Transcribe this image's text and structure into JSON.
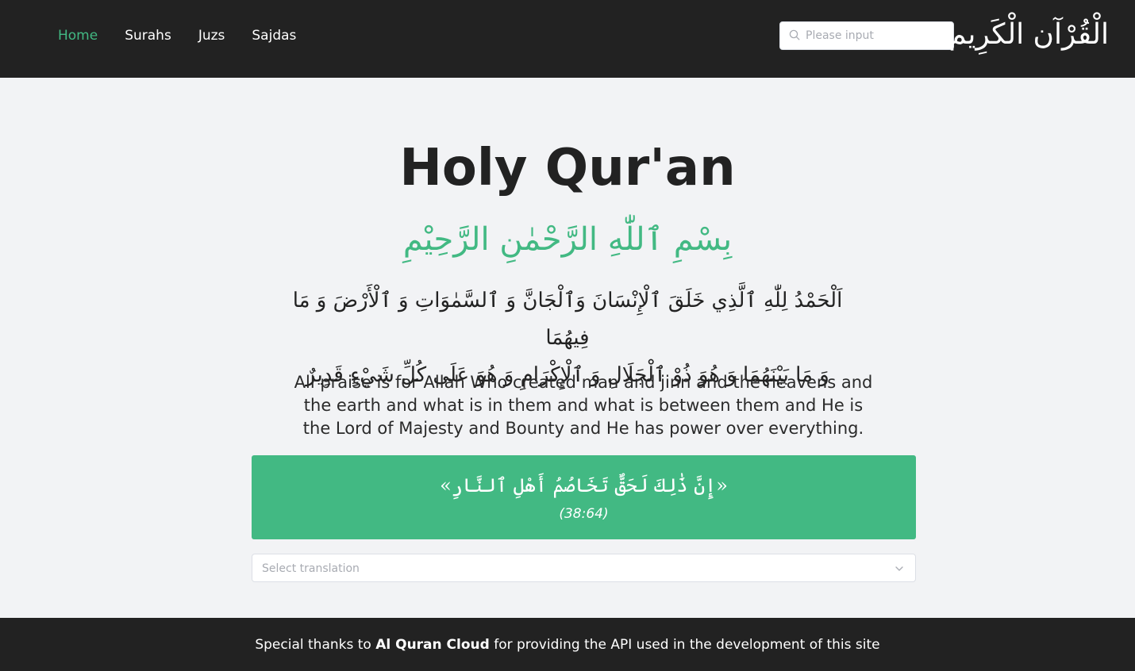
{
  "nav": {
    "items": [
      {
        "label": "Home",
        "active": true
      },
      {
        "label": "Surahs",
        "active": false
      },
      {
        "label": "Juzs",
        "active": false
      },
      {
        "label": "Sajdas",
        "active": false
      }
    ]
  },
  "search": {
    "placeholder": "Please input",
    "icon": "search-icon"
  },
  "logo": {
    "text": "الْقُرْآن الْكَرِيم"
  },
  "hero": {
    "title": "Holy Qur'an",
    "basmala": "بِسْمِ ٱللّٰهِ الرَّحْمٰنِ الرَّحِيْمِ",
    "arabic_line1": "اَلْحَمْدُ لِلّٰهِ ٱلَّذِي خَلَقَ ٱلْإِنْسَانَ وَٱلْجَانَّ وَ ٱلسَّمٰوَاتِ وَ ٱلْأَرْضَ وَ مَا فِيهُمَا",
    "arabic_line2": "وَ مَا بَيْنَهُمَا وَ هُوَ ذُوْ ٱلْجَلَالِ وَ ٱلْإِكْرَامِ وَ هُوَ عَلَى كُلِّ شَيْءٍ قَدِيرٌ",
    "english": "All praise is for Allah Who created man and jinn and the heavens and the earth and what is in them and what is between them and He is the Lord of Majesty and Bounty and He has power over everything."
  },
  "verse_card": {
    "arabic": "«إِنَّ ذَٰلِكَ لَحَقٌّ تَخَاصُمُ أَهْلِ ٱلنَّارِ»",
    "reference": "(38:64)",
    "color": "#42b983"
  },
  "translation_select": {
    "placeholder": "Select translation",
    "icon": "chevron-down-icon"
  },
  "footer": {
    "prefix": "Special thanks to ",
    "highlight": "Al Quran Cloud",
    "suffix": " for providing the API used in the development of this site"
  },
  "colors": {
    "accent": "#42b983",
    "header_bg": "#222222",
    "page_bg": "#f2f3f5"
  }
}
